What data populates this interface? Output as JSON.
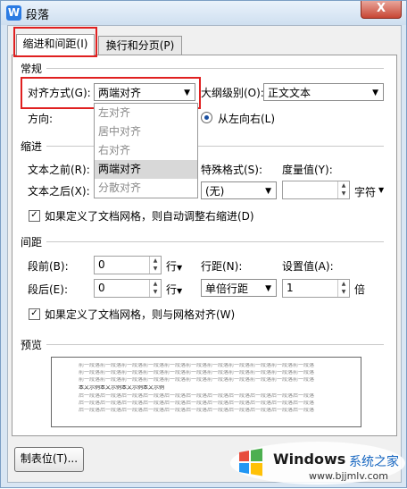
{
  "window": {
    "title": "段落",
    "app_icon": "W",
    "close_label": "X"
  },
  "tabs": [
    {
      "label": "缩进和间距(I)",
      "active": true
    },
    {
      "label": "换行和分页(P)",
      "active": false
    }
  ],
  "general": {
    "section_label": "常规",
    "alignment_label": "对齐方式(G):",
    "alignment_value": "两端对齐",
    "outline_label": "大纲级别(O):",
    "outline_value": "正文文本",
    "direction_label": "方向:",
    "direction_option": "从左向右(L)"
  },
  "alignment_dropdown": {
    "options": [
      "左对齐",
      "居中对齐",
      "右对齐",
      "两端对齐",
      "分散对齐"
    ],
    "selected": "两端对齐"
  },
  "indent": {
    "section_label": "缩进",
    "before_label": "文本之前(R):",
    "after_label": "文本之后(X):",
    "special_label": "特殊格式(S):",
    "special_value": "(无)",
    "measure_label": "度量值(Y):",
    "measure_unit": "字符",
    "grid_checkbox": "如果定义了文档网格，则自动调整右缩进(D)"
  },
  "spacing": {
    "section_label": "间距",
    "before_label": "段前(B):",
    "before_value": "0",
    "before_unit": "行",
    "after_label": "段后(E):",
    "after_value": "0",
    "after_unit": "行",
    "line_label": "行距(N):",
    "line_value": "单倍行距",
    "setting_label": "设置值(A):",
    "setting_value": "1",
    "setting_unit": "倍",
    "grid_checkbox": "如果定义了文档网格，则与网格对齐(W)"
  },
  "preview": {
    "section_label": "预览",
    "lines": [
      "前一段落前一段落前一段落前一段落前一段落前一段落前一段落前一段落前一段落前一段落前一段落",
      "前一段落前一段落前一段落前一段落前一段落前一段落前一段落前一段落前一段落前一段落前一段落",
      "前一段落前一段落前一段落前一段落前一段落前一段落前一段落前一段落前一段落前一段落前一段落",
      "本文示例本文示例本文示例本文示例",
      "后一段落后一段落后一段落后一段落后一段落后一段落后一段落后一段落后一段落后一段落后一段落",
      "后一段落后一段落后一段落后一段落后一段落后一段落后一段落后一段落后一段落后一段落后一段落",
      "后一段落后一段落后一段落后一段落后一段落后一段落后一段落后一段落后一段落后一段落后一段落"
    ]
  },
  "footer": {
    "tabs_button": "制表位(T)..."
  },
  "watermark": {
    "brand": "Windows",
    "suffix": "系统之家",
    "url": "www.bjjmlv.com"
  },
  "colors": {
    "highlight": "#e02020",
    "accent": "#2b7be3"
  }
}
